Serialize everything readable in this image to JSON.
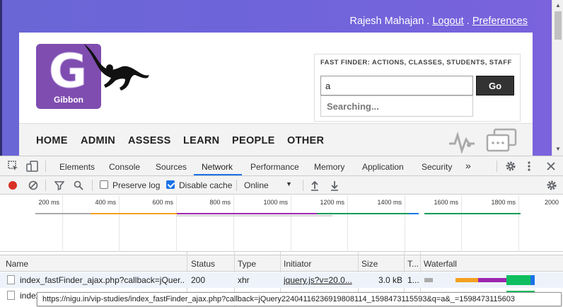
{
  "site": {
    "user": {
      "name": "Rajesh Mahajan",
      "sep1": " . ",
      "logout": "Logout",
      "sep2": " . ",
      "preferences": "Preferences"
    },
    "logo_text": "Gibbon",
    "logo_letter": "G",
    "fast_finder": {
      "title": "FAST FINDER: ACTIONS, CLASSES, STUDENTS, STAFF",
      "input_value": "a",
      "go_label": "Go",
      "suggestion": "Searching..."
    },
    "nav": [
      "HOME",
      "ADMIN",
      "ASSESS",
      "LEARN",
      "PEOPLE",
      "OTHER"
    ],
    "colors": {
      "bg": "#6f64da",
      "logo": "#7f4db0",
      "go_button": "#333333"
    }
  },
  "devtools": {
    "tabs": [
      "Elements",
      "Console",
      "Sources",
      "Network",
      "Performance",
      "Memory",
      "Application",
      "Security"
    ],
    "active_tab": "Network",
    "more_tabs": "»",
    "toolbar": {
      "preserve_log": "Preserve log",
      "disable_cache": "Disable cache",
      "throttle": "Online"
    },
    "timeline_ticks": [
      "200 ms",
      "400 ms",
      "600 ms",
      "800 ms",
      "1000 ms",
      "1200 ms",
      "1400 ms",
      "1600 ms",
      "1800 ms",
      "2000"
    ],
    "columns": {
      "name": "Name",
      "status": "Status",
      "type": "Type",
      "initiator": "Initiator",
      "size": "Size",
      "time": "T...",
      "waterfall": "Waterfall"
    },
    "rows": [
      {
        "name": "index_fastFinder_ajax.php?callback=jQuer...",
        "status": "200",
        "type": "xhr",
        "initiator": "jquery.js?v=20.0...",
        "size": "3.0 kB",
        "time": "1..."
      },
      {
        "name": "index_",
        "status": "",
        "type": "",
        "initiator": "",
        "size": "",
        "time": ""
      }
    ],
    "tooltip": "https://nigu.in/vip-studies/index_fastFinder_ajax.php?callback=jQuery22404116236919808114_1598473115593&q=a&_=1598473115603"
  }
}
